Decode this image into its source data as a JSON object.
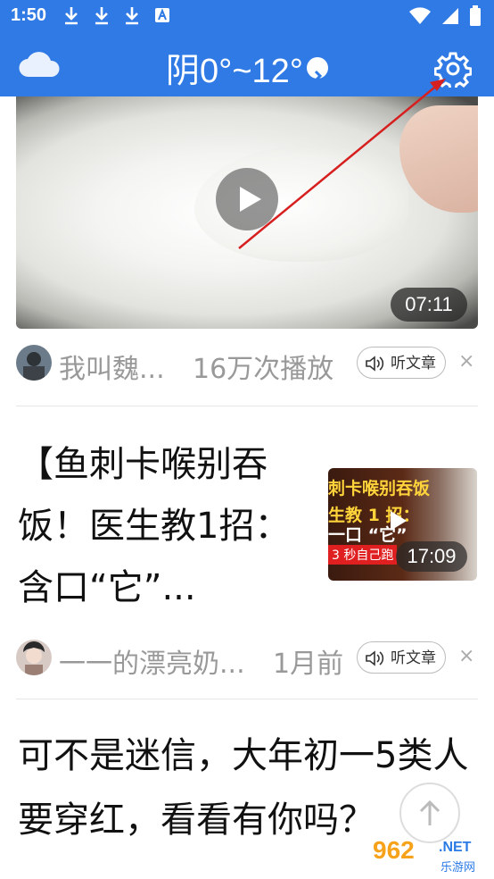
{
  "status_bar": {
    "time": "1:50",
    "icons": [
      "download-icon",
      "download-icon",
      "download-icon",
      "a-notification-icon"
    ],
    "right_icons": [
      "wifi-icon",
      "signal-icon",
      "battery-icon"
    ]
  },
  "header": {
    "weather_text": "阴0°~12°",
    "weather_icon": "cloud-icon",
    "settings_icon": "gear-icon",
    "accent_color": "#2f7ae5"
  },
  "feed": {
    "item1": {
      "duration": "07:11",
      "author": "我叫魏...",
      "stat": "16万次播放",
      "listen_label": "听文章",
      "close": "×"
    },
    "item2": {
      "title": "【鱼刺卡喉别吞饭！医生教1招：含口“它”...",
      "thumb_lines": [
        "刺卡喉别吞饭",
        "生教 1 招：",
        "一口 “它”",
        "3 秒自己跑"
      ],
      "duration": "17:09",
      "author": "一一的漂亮奶...",
      "stat": "1月前",
      "listen_label": "听文章",
      "close": "×"
    },
    "item3": {
      "title": "可不是迷信，大年初一5类人要穿红，看看有你吗？"
    }
  },
  "watermark": {
    "number": "962",
    "suffix": ".NET",
    "subtitle": "乐游网"
  }
}
